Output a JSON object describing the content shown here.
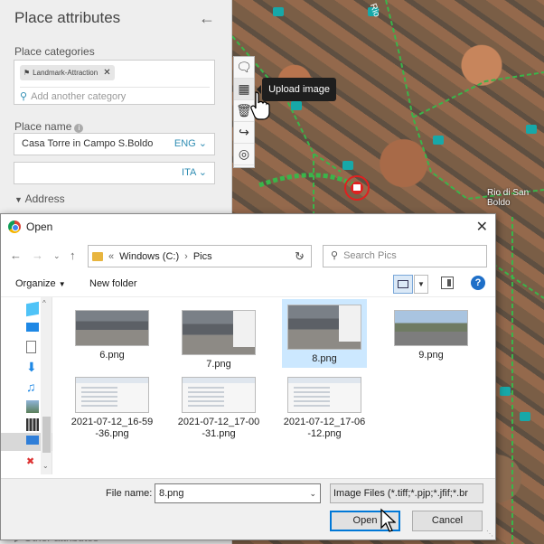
{
  "panel": {
    "title": "Place attributes",
    "categories_label": "Place categories",
    "category_chip": "Landmark-Attraction",
    "category_placeholder": "Add another category",
    "name_label": "Place name",
    "name_value": "Casa Torre in Campo S.Boldo",
    "name_lang_1": "ENG",
    "name_lang_2": "ITA",
    "address_label": "Address",
    "other_label": "Other attributes"
  },
  "toolbar": {
    "tooltip": "Upload image",
    "icons": [
      "comment-icon",
      "upload-image-icon",
      "delete-icon",
      "navigation-icon",
      "tripadvisor-icon"
    ]
  },
  "map": {
    "labels": [
      "Rio di San Boldo",
      "Rio"
    ]
  },
  "dialog": {
    "title": "Open",
    "breadcrumb_root": "Windows (C:)",
    "breadcrumb_folder": "Pics",
    "search_placeholder": "Search Pics",
    "organize": "Organize",
    "new_folder": "New folder",
    "files": [
      {
        "name": "6.png"
      },
      {
        "name": "7.png"
      },
      {
        "name": "8.png",
        "selected": true
      },
      {
        "name": "9.png"
      },
      {
        "name": "2021-07-12_16-59-36.png"
      },
      {
        "name": "2021-07-12_17-00-31.png"
      },
      {
        "name": "2021-07-12_17-06-12.png"
      }
    ],
    "file_name_label": "File name:",
    "file_name_value": "8.png",
    "file_type": "Image Files (*.tiff;*.pjp;*.jfif;*.br",
    "open_button": "Open",
    "cancel_button": "Cancel"
  },
  "colors": {
    "accent": "#2f8db3",
    "selection": "#cce8ff",
    "primary_border": "#0078d7"
  }
}
